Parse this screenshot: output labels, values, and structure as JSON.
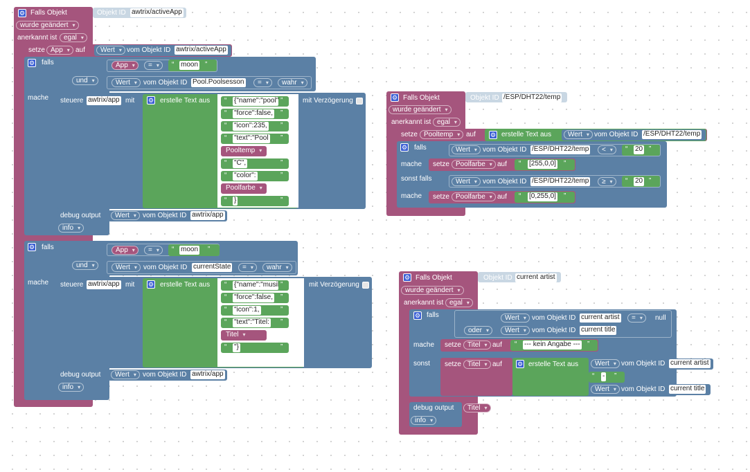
{
  "labels": {
    "falls_objekt": "Falls Objekt",
    "objekt_id": "Objekt ID",
    "wurde_geaendert": "wurde geändert",
    "anerkannt_ist": "anerkannt ist",
    "egal": "egal",
    "setze": "setze",
    "auf": "auf",
    "wert": "Wert",
    "vom_objekt_id": "vom Objekt ID",
    "falls": "falls",
    "mache": "mache",
    "und": "und",
    "oder": "oder",
    "sonst": "sonst",
    "sonst_falls": "sonst falls",
    "steuere": "steuere",
    "mit": "mit",
    "erstelle_text_aus": "erstelle Text aus",
    "mit_verzoegerung": "mit Verzögerung",
    "debug_output": "debug output",
    "info": "info",
    "eq": "=",
    "lt": "<",
    "gte": "≥",
    "quote": "“",
    "quote_close": "”",
    "null": "null",
    "gear": "⚙"
  },
  "script1": {
    "trigger_id": "awtrix/activeApp",
    "var_app": "App",
    "wert_id": "awtrix/activeApp",
    "if1": {
      "var": "App",
      "val": "moon",
      "state_id": "Pool.Poolsesson",
      "state_val": "wahr",
      "target": "awtrix/app",
      "texts": [
        "{\"name\":\"pool\",",
        "\"force\":false,",
        "\"icon\":235,",
        "\"text\":\"Pool",
        "Pooltemp",
        "\"C\",",
        "\"color\":",
        "Poolfarbe",
        "}"
      ],
      "debug_id": "awtrix/app"
    },
    "if2": {
      "var": "App",
      "val": "moon",
      "state_id": "currentState",
      "state_val": "wahr",
      "target": "awtrix/app",
      "texts": [
        "{\"name\":\"musik\",",
        "\"force\":false,",
        "\"icon\":1,",
        "\"text\":\"Titel:",
        "Titel",
        "\"}"
      ],
      "debug_id": "awtrix/app"
    }
  },
  "script2": {
    "trigger_id": "/ESP/DHT22/temp",
    "var": "Pooltemp",
    "wert_id": "/ESP/DHT22/temp",
    "if_id": "/ESP/DHT22/temp",
    "if_val": "20",
    "color1": "[255,0,0]",
    "elif_id": "/ESP/DHT22/temp",
    "elif_val": "20",
    "color2": "[0,255,0]",
    "var2": "Poolfarbe"
  },
  "script3": {
    "trigger_id": "current artist",
    "cond_id1": "current artist",
    "cond_id2": "current title",
    "var": "Titel",
    "no_info": "--- kein Angabe ---",
    "sep": " - ",
    "else_id1": "current artist",
    "else_id2": "current title",
    "debug_var": "Titel"
  },
  "colors": {
    "event": "#a5557d",
    "logic": "#5b80a5",
    "text": "#5ba55b"
  }
}
